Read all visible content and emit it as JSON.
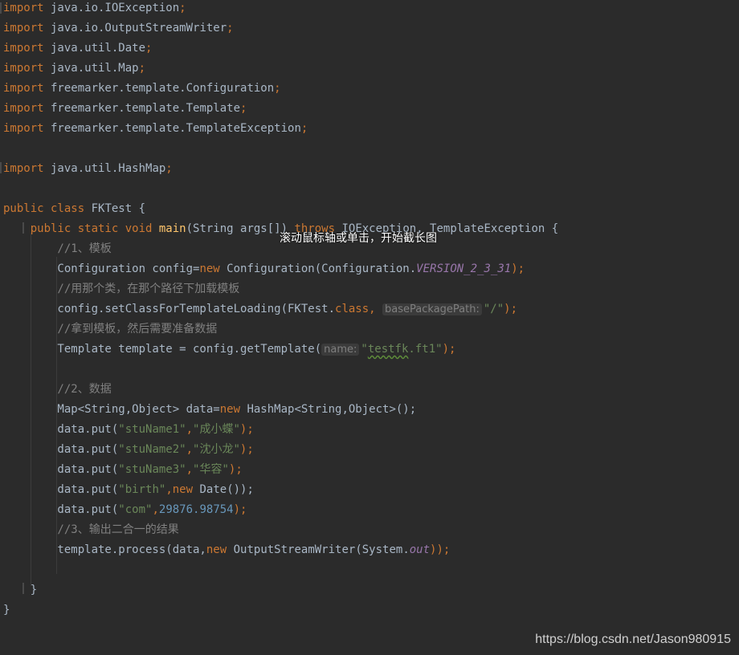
{
  "editor": {
    "language": "java",
    "theme_colors": {
      "background": "#2b2b2b",
      "keyword": "#cc7832",
      "string": "#6a8759",
      "number": "#6897bb",
      "comment": "#808080",
      "method": "#ffc66d",
      "field": "#9876aa",
      "text": "#a9b7c6"
    },
    "lines": [
      [
        {
          "t": "import",
          "c": "kw"
        },
        {
          "t": " java.io.IOException",
          "c": "plain"
        },
        {
          "t": ";",
          "c": "kw"
        }
      ],
      [
        {
          "t": "import",
          "c": "kw"
        },
        {
          "t": " java.io.OutputStreamWriter",
          "c": "plain"
        },
        {
          "t": ";",
          "c": "kw"
        }
      ],
      [
        {
          "t": "import",
          "c": "kw"
        },
        {
          "t": " java.util.Date",
          "c": "plain"
        },
        {
          "t": ";",
          "c": "kw"
        }
      ],
      [
        {
          "t": "import",
          "c": "kw"
        },
        {
          "t": " java.util.Map",
          "c": "plain"
        },
        {
          "t": ";",
          "c": "kw"
        }
      ],
      [
        {
          "t": "import",
          "c": "kw"
        },
        {
          "t": " freemarker.template.Configuration",
          "c": "plain"
        },
        {
          "t": ";",
          "c": "kw"
        }
      ],
      [
        {
          "t": "import",
          "c": "kw"
        },
        {
          "t": " freemarker.template.Template",
          "c": "plain"
        },
        {
          "t": ";",
          "c": "kw"
        }
      ],
      [
        {
          "t": "import",
          "c": "kw"
        },
        {
          "t": " freemarker.template.TemplateException",
          "c": "plain"
        },
        {
          "t": ";",
          "c": "kw"
        }
      ],
      [],
      [
        {
          "t": "import",
          "c": "kw"
        },
        {
          "t": " java.util.HashMap",
          "c": "plain"
        },
        {
          "t": ";",
          "c": "kw"
        }
      ],
      [],
      [
        {
          "t": "public class",
          "c": "kw"
        },
        {
          "t": " FKTest {",
          "c": "plain"
        }
      ],
      [
        {
          "t": "    public static void",
          "c": "kw"
        },
        {
          "t": " ",
          "c": "plain"
        },
        {
          "t": "main",
          "c": "fn"
        },
        {
          "t": "(String args[]) ",
          "c": "plain"
        },
        {
          "t": "throws",
          "c": "kw"
        },
        {
          "t": " IOException, TemplateException {",
          "c": "plain"
        }
      ],
      [
        {
          "t": "        //1、模板",
          "c": "cmt"
        }
      ],
      [
        {
          "t": "        Configuration config=",
          "c": "plain"
        },
        {
          "t": "new",
          "c": "kw"
        },
        {
          "t": " Configuration(Configuration.",
          "c": "plain"
        },
        {
          "t": "VERSION_2_3_31",
          "c": "field"
        },
        {
          "t": ");",
          "c": "kw"
        }
      ],
      [
        {
          "t": "        //用那个类，在那个路径下加载模板",
          "c": "cmt"
        }
      ],
      [
        {
          "t": "        config.setClassForTemplateLoading(FKTest.",
          "c": "plain"
        },
        {
          "t": "class,",
          "c": "kw"
        },
        {
          "t": " ",
          "c": "plain"
        },
        {
          "t": "basePackagePath:",
          "c": "hint"
        },
        {
          "t": "\"/\"",
          "c": "str"
        },
        {
          "t": ");",
          "c": "kw"
        }
      ],
      [
        {
          "t": "        //拿到模板，然后需要准备数据",
          "c": "cmt"
        }
      ],
      [
        {
          "t": "        Template template = config.getTemplate(",
          "c": "plain"
        },
        {
          "t": "name:",
          "c": "hint"
        },
        {
          "t": "\"",
          "c": "str"
        },
        {
          "t": "testfk",
          "c": "str squiggle"
        },
        {
          "t": ".ft1\"",
          "c": "str"
        },
        {
          "t": ");",
          "c": "kw"
        }
      ],
      [],
      [
        {
          "t": "        //2、数据",
          "c": "cmt"
        }
      ],
      [
        {
          "t": "        Map<String,Object> data=",
          "c": "plain"
        },
        {
          "t": "new",
          "c": "kw"
        },
        {
          "t": " HashMap<String,Object>();",
          "c": "plain"
        }
      ],
      [
        {
          "t": "        data.put(",
          "c": "plain"
        },
        {
          "t": "\"stuName1\"",
          "c": "str"
        },
        {
          "t": ",",
          "c": "kw"
        },
        {
          "t": "\"成小蝶\"",
          "c": "str"
        },
        {
          "t": ");",
          "c": "kw"
        }
      ],
      [
        {
          "t": "        data.put(",
          "c": "plain"
        },
        {
          "t": "\"stuName2\"",
          "c": "str"
        },
        {
          "t": ",",
          "c": "kw"
        },
        {
          "t": "\"沈小龙\"",
          "c": "str"
        },
        {
          "t": ");",
          "c": "kw"
        }
      ],
      [
        {
          "t": "        data.put(",
          "c": "plain"
        },
        {
          "t": "\"stuName3\"",
          "c": "str"
        },
        {
          "t": ",",
          "c": "kw"
        },
        {
          "t": "\"华容\"",
          "c": "str"
        },
        {
          "t": ");",
          "c": "kw"
        }
      ],
      [
        {
          "t": "        data.put(",
          "c": "plain"
        },
        {
          "t": "\"birth\"",
          "c": "str"
        },
        {
          "t": ",",
          "c": "kw"
        },
        {
          "t": "new",
          "c": "kw"
        },
        {
          "t": " Date());",
          "c": "plain"
        }
      ],
      [
        {
          "t": "        data.put(",
          "c": "plain"
        },
        {
          "t": "\"com\"",
          "c": "str"
        },
        {
          "t": ",",
          "c": "kw"
        },
        {
          "t": "29876.98754",
          "c": "num"
        },
        {
          "t": ");",
          "c": "kw"
        }
      ],
      [
        {
          "t": "        //3、输出二合一的结果",
          "c": "cmt"
        }
      ],
      [
        {
          "t": "        template.process(data,",
          "c": "plain"
        },
        {
          "t": "new",
          "c": "kw"
        },
        {
          "t": " OutputStreamWriter(System.",
          "c": "plain"
        },
        {
          "t": "out",
          "c": "field"
        },
        {
          "t": "));",
          "c": "kw"
        }
      ],
      [],
      [
        {
          "t": "    }",
          "c": "plain"
        }
      ],
      [
        {
          "t": "}",
          "c": "plain"
        }
      ]
    ]
  },
  "overlay": {
    "tooltip": "滚动鼠标轴或单击，开始截长图"
  },
  "watermark": "https://blog.csdn.net/Jason980915"
}
